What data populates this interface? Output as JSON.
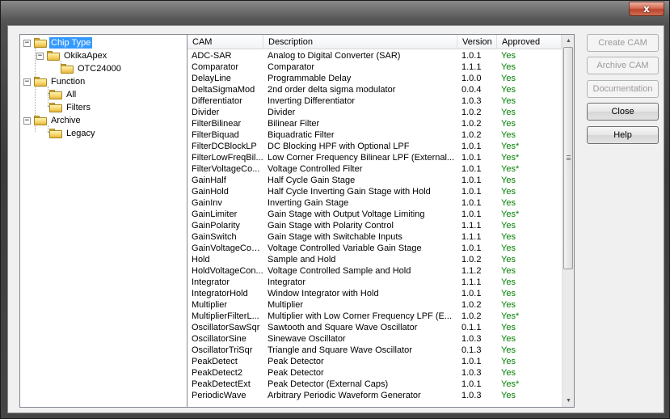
{
  "window": {
    "close_label": "x"
  },
  "tree": {
    "nodes": [
      {
        "label": "Chip Type",
        "expander": "−"
      },
      {
        "label": "OkikaApex",
        "expander": "−"
      },
      {
        "label": "OTC24000"
      },
      {
        "label": "Function",
        "expander": "−"
      },
      {
        "label": "All"
      },
      {
        "label": "Filters"
      },
      {
        "label": "Archive",
        "expander": "−"
      },
      {
        "label": "Legacy"
      }
    ]
  },
  "list": {
    "headers": {
      "cam": "CAM",
      "description": "Description",
      "version": "Version",
      "approved": "Approved"
    },
    "rows": [
      [
        "ADC-SAR",
        "Analog to Digital Converter (SAR)",
        "1.0.1",
        "Yes"
      ],
      [
        "Comparator",
        "Comparator",
        "1.1.1",
        "Yes"
      ],
      [
        "DelayLine",
        "Programmable Delay",
        "1.0.0",
        "Yes"
      ],
      [
        "DeltaSigmaMod",
        "2nd order delta sigma modulator",
        "0.0.4",
        "Yes"
      ],
      [
        "Differentiator",
        "Inverting Differentiator",
        "1.0.3",
        "Yes"
      ],
      [
        "Divider",
        "Divider",
        "1.0.2",
        "Yes"
      ],
      [
        "FilterBilinear",
        "Bilinear Filter",
        "1.0.2",
        "Yes"
      ],
      [
        "FilterBiquad",
        "Biquadratic Filter",
        "1.0.2",
        "Yes"
      ],
      [
        "FilterDCBlockLP",
        "DC Blocking HPF with Optional LPF",
        "1.0.1",
        "Yes*"
      ],
      [
        "FilterLowFreqBil...",
        "Low Corner Frequency Bilinear LPF (External...",
        "1.0.1",
        "Yes*"
      ],
      [
        "FilterVoltageCo...",
        "Voltage Controlled Filter",
        "1.0.1",
        "Yes*"
      ],
      [
        "GainHalf",
        "Half Cycle Gain Stage",
        "1.0.1",
        "Yes"
      ],
      [
        "GainHold",
        "Half Cycle Inverting Gain Stage with Hold",
        "1.0.1",
        "Yes"
      ],
      [
        "GainInv",
        "Inverting Gain Stage",
        "1.0.1",
        "Yes"
      ],
      [
        "GainLimiter",
        "Gain Stage with Output Voltage Limiting",
        "1.0.1",
        "Yes*"
      ],
      [
        "GainPolarity",
        "Gain Stage with Polarity Control",
        "1.1.1",
        "Yes"
      ],
      [
        "GainSwitch",
        "Gain Stage with Switchable Inputs",
        "1.1.1",
        "Yes"
      ],
      [
        "GainVoltageCon...",
        "Voltage Controlled Variable Gain Stage",
        "1.0.1",
        "Yes"
      ],
      [
        "Hold",
        "Sample and Hold",
        "1.0.2",
        "Yes"
      ],
      [
        "HoldVoltageCon...",
        "Voltage Controlled Sample and Hold",
        "1.1.2",
        "Yes"
      ],
      [
        "Integrator",
        "Integrator",
        "1.1.1",
        "Yes"
      ],
      [
        "IntegratorHold",
        "Window Integrator with Hold",
        "1.0.1",
        "Yes"
      ],
      [
        "Multiplier",
        "Multiplier",
        "1.0.2",
        "Yes"
      ],
      [
        "MultiplierFilterL...",
        "Multiplier with Low Corner Frequency LPF (E...",
        "1.0.2",
        "Yes*"
      ],
      [
        "OscillatorSawSqr",
        "Sawtooth and Square Wave Oscillator",
        "0.1.1",
        "Yes"
      ],
      [
        "OscillatorSine",
        "Sinewave Oscillator",
        "1.0.3",
        "Yes"
      ],
      [
        "OscillatorTriSqr",
        "Triangle and Square Wave Oscillator",
        "0.1.3",
        "Yes"
      ],
      [
        "PeakDetect",
        "Peak Detector",
        "1.0.1",
        "Yes"
      ],
      [
        "PeakDetect2",
        "Peak Detector",
        "1.0.3",
        "Yes"
      ],
      [
        "PeakDetectExt",
        "Peak Detector (External Caps)",
        "1.0.1",
        "Yes*"
      ],
      [
        "PeriodicWave",
        "Arbitrary Periodic Waveform Generator",
        "1.0.3",
        "Yes"
      ]
    ]
  },
  "buttons": {
    "create_cam": "Create CAM",
    "archive_cam": "Archive CAM",
    "documentation": "Documentation",
    "close": "Close",
    "help": "Help"
  }
}
